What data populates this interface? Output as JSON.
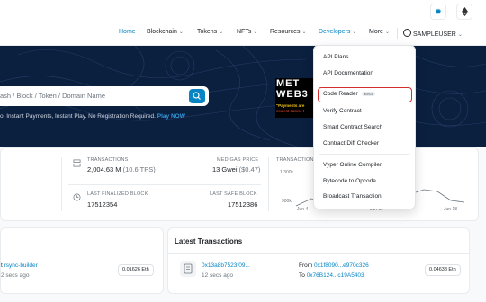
{
  "nav": {
    "items": [
      {
        "label": "Home",
        "active": true,
        "dropdown": false
      },
      {
        "label": "Blockchain",
        "dropdown": true
      },
      {
        "label": "Tokens",
        "dropdown": true
      },
      {
        "label": "NFTs",
        "dropdown": true
      },
      {
        "label": "Resources",
        "dropdown": true
      },
      {
        "label": "Developers",
        "dropdown": true,
        "active": true
      },
      {
        "label": "More",
        "dropdown": true
      }
    ],
    "user": "SAMPLEUSER"
  },
  "hero": {
    "search_placeholder": "ash / Block / Token / Domain Name",
    "subtext": "o. Instant Payments, Instant Play. No Registration Required.",
    "subtext_link": "Play NOW",
    "ad": {
      "line1": "MET",
      "line2": "WEB3",
      "line3": "\"Payments are",
      "line4": "coolest casino t"
    }
  },
  "stats": {
    "transactions_label": "TRANSACTIONS",
    "transactions_value": "2,004.63 M",
    "transactions_tps": "(10.6 TPS)",
    "gas_label": "MED GAS PRICE",
    "gas_value": "13 Gwei",
    "gas_usd": "($0.47)",
    "finalized_label": "LAST FINALIZED BLOCK",
    "finalized_value": "17512354",
    "safe_label": "LAST SAFE BLOCK",
    "safe_value": "17512386",
    "chart_label": "TRANSACTION",
    "chart_y_top": "1,300k",
    "chart_y_bottom": "900k",
    "chart_x": [
      "Jun 4",
      "Jun 11",
      "Jun 18"
    ]
  },
  "blocks": {
    "builder_link": "rsync-builder",
    "time": "2 secs ago",
    "reward": "0.01626 Eth"
  },
  "latest_transactions": {
    "title": "Latest Transactions",
    "hash": "0x13a8b7523f09...",
    "time": "12 secs ago",
    "from_label": "From",
    "from": "0x1f8090...e970c326",
    "to_label": "To",
    "to": "0x76B124...c19A5403",
    "value": "0.04638 Eth"
  },
  "dropdown": {
    "items": [
      "API Plans",
      "API Documentation",
      "Code Reader",
      "Verify Contract",
      "Smart Contract Search",
      "Contract Diff Checker",
      "Vyper Online Compiler",
      "Bytecode to Opcode",
      "Broadcast Transaction"
    ],
    "beta_label": "Beta"
  },
  "colors": {
    "accent": "#0784c3",
    "hero_bg": "#0b1f3f",
    "highlight": "#d32f2f"
  }
}
